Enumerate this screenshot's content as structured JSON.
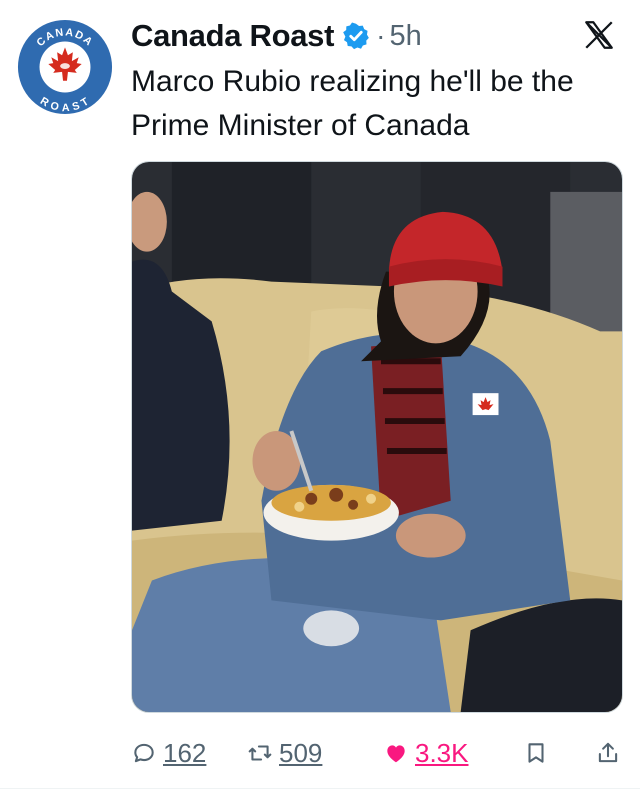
{
  "account": {
    "name": "Canada Roast",
    "time_separator": "·",
    "time": "5h",
    "avatar_top_text": "CANADA",
    "avatar_bottom_text": "ROAST"
  },
  "tweet": {
    "text": "Marco Rubio realizing he'll be the Prime Minister of Canada"
  },
  "actions": {
    "replies": "162",
    "reposts": "509",
    "likes": "3.3K"
  },
  "colors": {
    "accent_blue": "#1d9bf0",
    "like_pink": "#f91880",
    "secondary_text": "#536471",
    "avatar_blue": "#2f6bb0",
    "maple_red": "#d52b1e"
  },
  "icons": [
    "verified-badge-icon",
    "x-logo-icon",
    "reply-icon",
    "repost-icon",
    "like-heart-icon",
    "bookmark-icon",
    "share-icon"
  ]
}
